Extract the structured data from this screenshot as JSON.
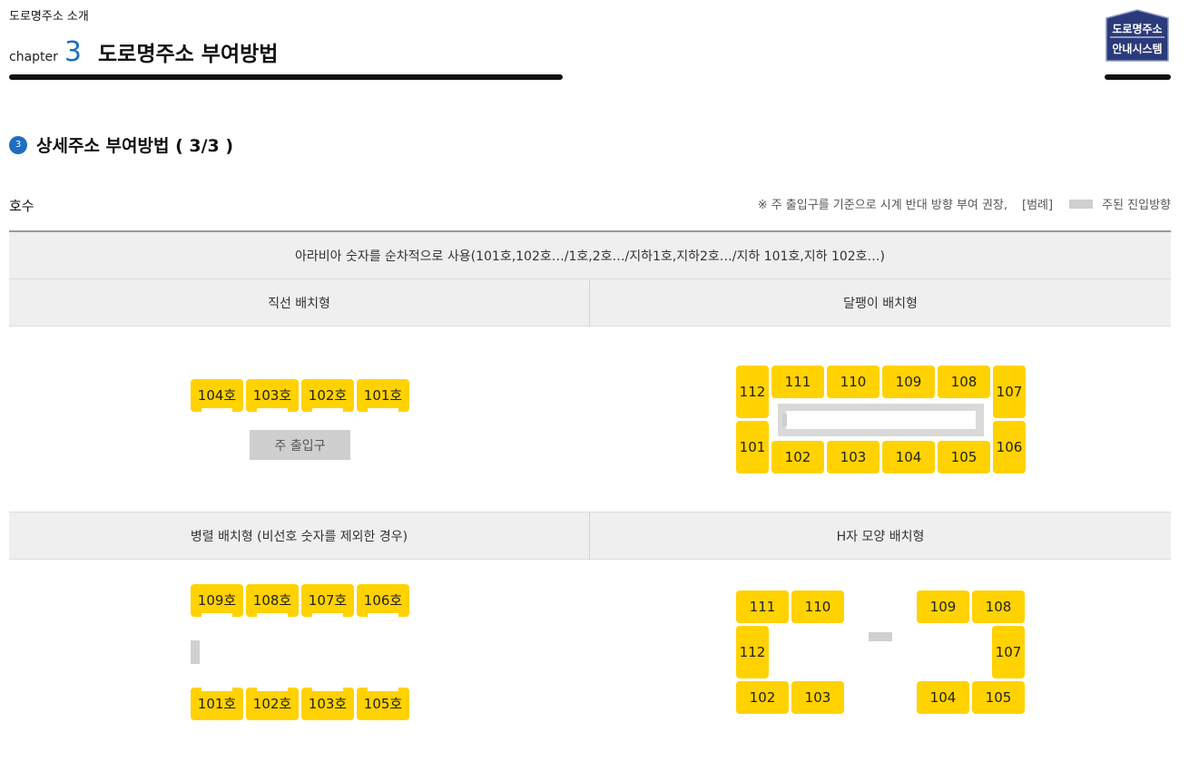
{
  "header": {
    "super_title": "도로명주소 소개",
    "chapter_label": "chapter",
    "chapter_number": "3",
    "chapter_title": "도로명주소 부여방법",
    "logo_line1": "도로명주소",
    "logo_line2": "안내시스템"
  },
  "section": {
    "number": "3",
    "title": "상세주소 부여방법 ( 3/3 )"
  },
  "hosu_label": "호수",
  "note": {
    "text": "※ 주 출입구를 기준으로 시계 반대 방향 부여 권장,",
    "legend_label": "[범례]",
    "legend_item": "주된 진입방향"
  },
  "table": {
    "header_row": "아라비아 숫자를 순차적으로 사용(101호,102호…/1호,2호…/지하1호,지하2호…/지하 101호,지하 102호…)",
    "straight_title": "직선 배치형",
    "snail_title": "달팽이 배치형",
    "parallel_title": "병렬 배치형 (비선호 숫자를 제외한 경우)",
    "hshape_title": "H자 모양 배치형"
  },
  "straight": {
    "rooms": [
      "104호",
      "103호",
      "102호",
      "101호"
    ],
    "entrance": "주 출입구"
  },
  "snail": {
    "top": [
      "111",
      "110",
      "109",
      "108"
    ],
    "bottom": [
      "102",
      "103",
      "104",
      "105"
    ],
    "left_top": "112",
    "left_bottom": "101",
    "right_top": "107",
    "right_bottom": "106"
  },
  "parallel": {
    "top": [
      "109호",
      "108호",
      "107호",
      "106호"
    ],
    "bottom": [
      "101호",
      "102호",
      "103호",
      "105호"
    ]
  },
  "hshape": {
    "left_top": [
      "111",
      "110"
    ],
    "left_mid": "112",
    "left_bottom": [
      "102",
      "103"
    ],
    "right_top": [
      "109",
      "108"
    ],
    "right_mid": "107",
    "right_bottom": [
      "104",
      "105"
    ]
  },
  "colors": {
    "accent_blue": "#1e6fc1",
    "room_yellow": "#ffd200",
    "row_gray": "#efefef",
    "entry_gray": "#cfcfcf",
    "logo_navy": "#2b3a7a"
  }
}
